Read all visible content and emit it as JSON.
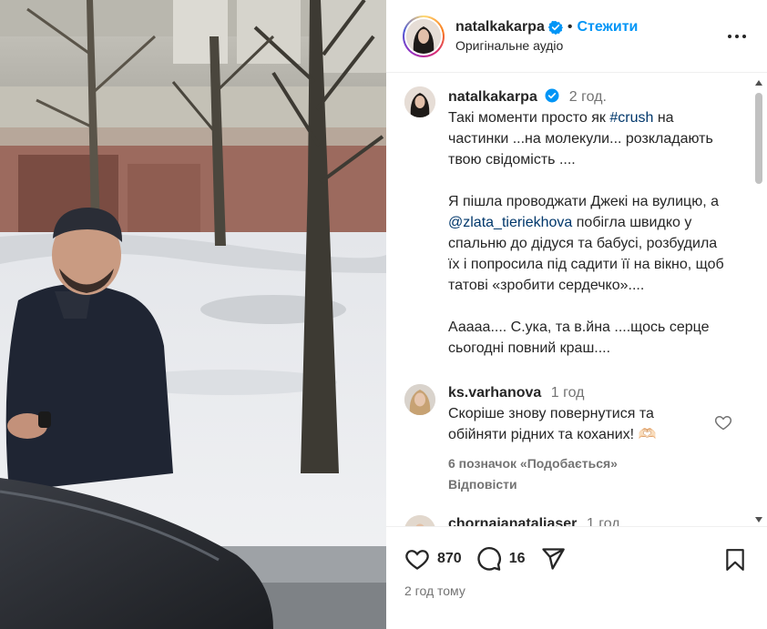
{
  "post": {
    "author": "natalkakarpa",
    "follow_label": "Стежити",
    "separator": "•",
    "audio": "Оригінальне аудіо",
    "caption": {
      "author": "natalkakarpa",
      "time": "2 год.",
      "p1_a": "Такі моменти просто як ",
      "p1_hashtag": "#crush",
      "p1_b": " на частинки ...на молекули... розкладають твою свідомість ....",
      "p2_a": "Я пішла проводжати Джекі на вулицю, а ",
      "p2_mention": "@zlata_tieriekhova",
      "p2_b": " побігла швидко у спальню до дідуся та бабусі, розбудила їх і попросила під садити її на вікно, щоб татові «зробити сердечко»....",
      "p3": "Ааааа.... С.ука, та в.йна ....щось серце сьогодні повний краш...."
    },
    "comments": [
      {
        "author": "ks.varhanova",
        "time": "1 год",
        "text": "Скоріше знову повернутися та обійняти рідних та коханих! 🫶🏻",
        "likes": "6 позначок «Подобається»",
        "reply": "Відповісти"
      },
      {
        "author": "chornaianataliaser",
        "time": "1 год"
      }
    ],
    "likes_count": "870",
    "comments_count": "16",
    "posted_ago": "2 год тому"
  },
  "colors": {
    "accent": "#0095f6",
    "verified": "#0095f6",
    "muted": "#737373",
    "link": "#00376b"
  }
}
